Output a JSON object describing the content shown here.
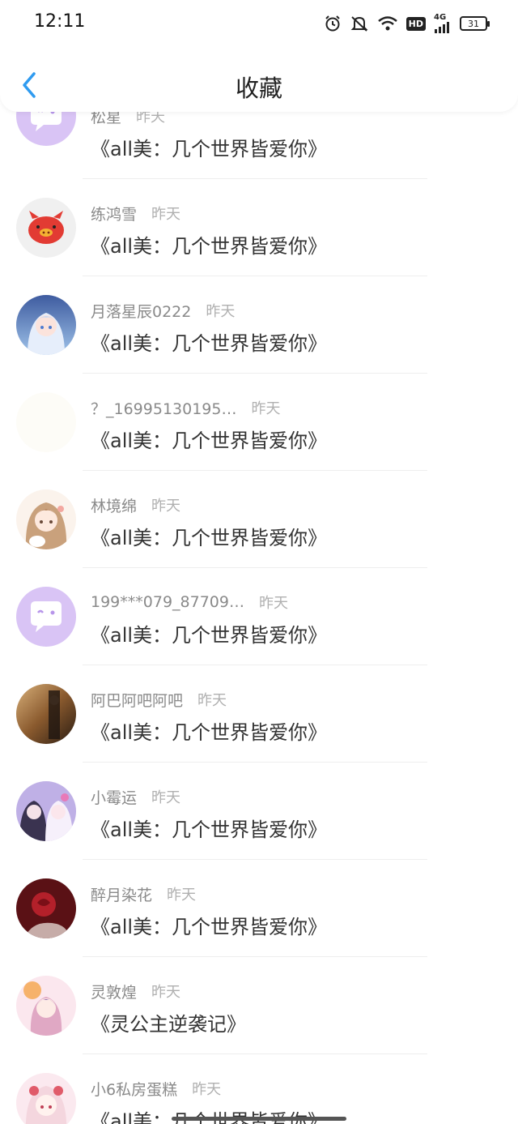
{
  "status_bar": {
    "time": "12:11",
    "hd_badge": "HD",
    "network": "4G",
    "battery": "31"
  },
  "header": {
    "title": "收藏",
    "back_icon": "chevron-left-icon",
    "accent_color": "#2f9bf0"
  },
  "items": [
    {
      "user": "松星",
      "time": "昨天",
      "book": "《all美：几个世界皆爱你》",
      "avatar": "default-chat-avatar"
    },
    {
      "user": "练鸿雪",
      "time": "昨天",
      "book": "《all美：几个世界皆爱你》",
      "avatar": "pig-avatar"
    },
    {
      "user": "月落星辰0222",
      "time": "昨天",
      "book": "《all美：几个世界皆爱你》",
      "avatar": "anime-girl-avatar"
    },
    {
      "user": "？_16995130195…",
      "time": "昨天",
      "book": "《all美：几个世界皆爱你》",
      "avatar": "blank-avatar"
    },
    {
      "user": "林境绵",
      "time": "昨天",
      "book": "《all美：几个世界皆爱你》",
      "avatar": "anime-girl-avatar"
    },
    {
      "user": "199***079_87709…",
      "time": "昨天",
      "book": "《all美：几个世界皆爱你》",
      "avatar": "default-chat-avatar"
    },
    {
      "user": "阿巴阿吧阿吧",
      "time": "昨天",
      "book": "《all美：几个世界皆爱你》",
      "avatar": "photo-avatar"
    },
    {
      "user": "小霉运",
      "time": "昨天",
      "book": "《all美：几个世界皆爱你》",
      "avatar": "anime-girls-avatar"
    },
    {
      "user": "醉月染花",
      "time": "昨天",
      "book": "《all美：几个世界皆爱你》",
      "avatar": "rose-avatar"
    },
    {
      "user": "灵敦煌",
      "time": "昨天",
      "book": "《灵公主逆袭记》",
      "avatar": "anime-girl-avatar"
    },
    {
      "user": "小6私房蛋糕",
      "time": "昨天",
      "book": "《all美：几个世界皆爱你》",
      "avatar": "anime-girl-avatar"
    }
  ]
}
